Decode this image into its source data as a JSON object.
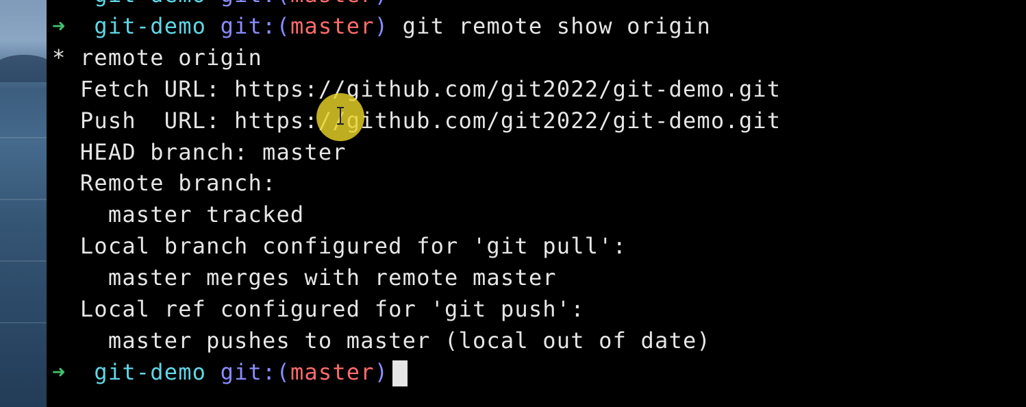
{
  "prompt": {
    "arrow": "➜",
    "directory": "git-demo",
    "git_label": "git:(",
    "branch": "master",
    "git_close": ")"
  },
  "top_partial_line": {
    "directory": "git-demo",
    "git_label": "git:(",
    "branch": "master",
    "git_close": ")"
  },
  "command": "git remote show origin",
  "output": [
    "* remote origin",
    "  Fetch URL: https://github.com/git2022/git-demo.git",
    "  Push  URL: https://github.com/git2022/git-demo.git",
    "  HEAD branch: master",
    "  Remote branch:",
    "    master tracked",
    "  Local branch configured for 'git pull':",
    "    master merges with remote master",
    "  Local ref configured for 'git push':",
    "    master pushes to master (local out of date)"
  ],
  "colors": {
    "arrow": "#3ec26a",
    "directory": "#5fd7e6",
    "git_label": "#8a8cff",
    "branch": "#ff6b6b",
    "text": "#e6e6e6",
    "background": "#000000",
    "pointer_highlight": "#e8d228"
  }
}
